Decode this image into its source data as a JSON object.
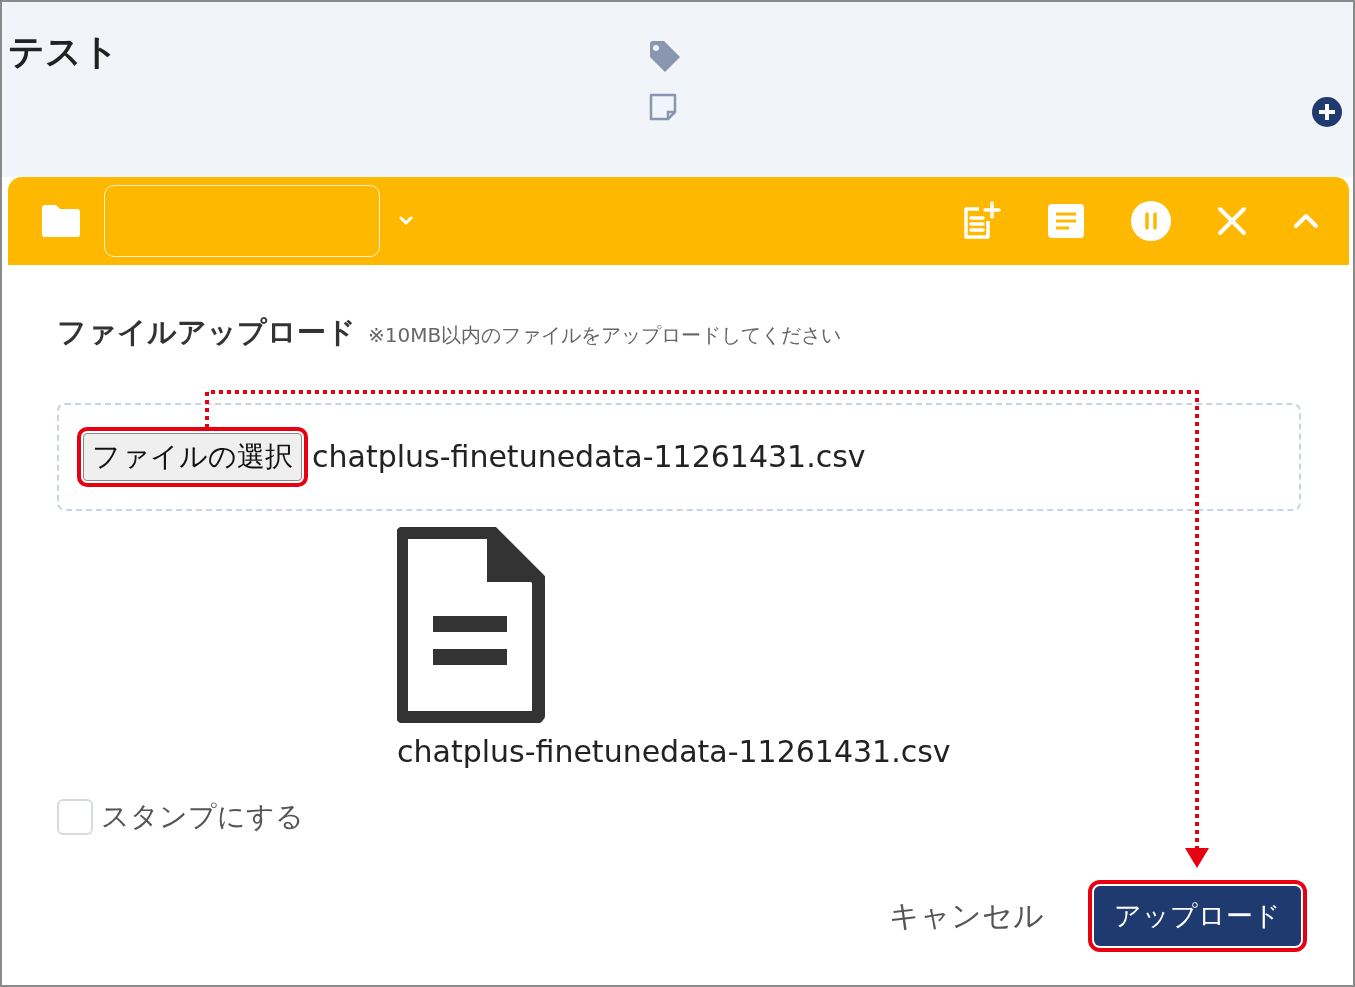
{
  "header": {
    "title": "テスト"
  },
  "upload": {
    "title": "ファイルアップロード",
    "note": "※10MB以内のファイルをアップロードしてください",
    "choose_button": {
      "label": "ファイルの選択",
      "highlighted": true
    },
    "chosen_file": "chatplus-finetunedata-11261431.csv",
    "preview_filename": "chatplus-finetunedata-11261431.csv"
  },
  "stamp_checkbox": {
    "label": "スタンプにする",
    "checked": false
  },
  "cancel_button": {
    "label": "キャンセル"
  },
  "upload_button": {
    "label": "アップロード",
    "highlighted": true
  }
}
